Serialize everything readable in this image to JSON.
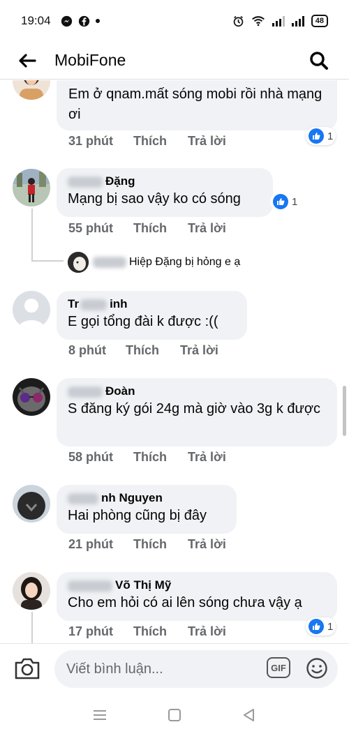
{
  "status_bar": {
    "time": "19:04",
    "battery": "48",
    "left_icons": [
      "messenger-icon",
      "facebook-icon",
      "dot-icon"
    ],
    "right_icons": [
      "alarm-icon",
      "wifi-icon",
      "signal-icon",
      "signal-icon"
    ]
  },
  "header": {
    "title": "MobiFone",
    "back_icon": "arrow-left-icon",
    "search_icon": "search-icon"
  },
  "comments": [
    {
      "name_visible": "",
      "text": "Em ở qnam.mất sóng mobi rồi nhà mạng ơi",
      "time": "31 phút",
      "like_label": "Thích",
      "reply_label": "Trả lời",
      "reaction_count": "1"
    },
    {
      "name_visible": "Đặng",
      "text": "Mạng bị sao vậy ko có sóng",
      "time": "55 phút",
      "like_label": "Thích",
      "reply_label": "Trả lời",
      "reaction_count": "1",
      "reply_preview": "Hiệp Đặng bị hỏng e ạ"
    },
    {
      "name_visible": "Tr... inh",
      "name_prefix": "Tr",
      "name_suffix": "inh",
      "text": "E gọi tổng đài k được :((",
      "time": "8 phút",
      "like_label": "Thích",
      "reply_label": "Trả lời"
    },
    {
      "name_visible": "Đoàn",
      "text": "S   đăng ký gói 24g mà giờ vào 3g k được",
      "time": "58 phút",
      "like_label": "Thích",
      "reply_label": "Trả lời"
    },
    {
      "name_visible": "nh Nguyen",
      "text": "Hai phòng cũng bị đây",
      "time": "21 phút",
      "like_label": "Thích",
      "reply_label": "Trả lời"
    },
    {
      "name_visible": "Võ Thị Mỹ",
      "text": "Cho em hỏi có ai lên sóng chưa vậy ạ",
      "time": "17 phút",
      "like_label": "Thích",
      "reply_label": "Trả lời",
      "reaction_count": "1"
    }
  ],
  "composer": {
    "placeholder": "Viết bình luận...",
    "gif_label": "GIF",
    "camera_icon": "camera-icon",
    "emoji_icon": "emoji-icon"
  },
  "navbar": {
    "icons": [
      "menu-icon",
      "home-icon",
      "back-triangle-icon"
    ]
  },
  "colors": {
    "bubble": "#f0f2f5",
    "like_blue": "#1877f2",
    "secondary_text": "#65676b"
  }
}
